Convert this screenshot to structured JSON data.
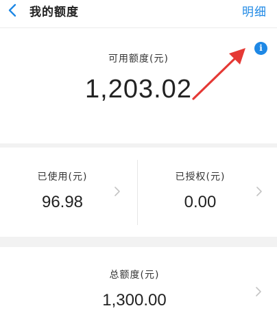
{
  "header": {
    "title": "我的额度",
    "detail_link": "明细",
    "back_icon": "chevron-left-icon"
  },
  "available": {
    "label": "可用额度(元)",
    "amount": "1,203.02",
    "info_icon": "info-icon",
    "info_glyph": "i"
  },
  "breakdown": {
    "used": {
      "label": "已使用(元)",
      "value": "96.98"
    },
    "authorized": {
      "label": "已授权(元)",
      "value": "0.00"
    }
  },
  "total": {
    "label": "总额度(元)",
    "value": "1,300.00"
  },
  "colors": {
    "accent": "#1e88e5",
    "annotation_arrow": "#e53935",
    "section_gap": "#f2f2f2"
  }
}
